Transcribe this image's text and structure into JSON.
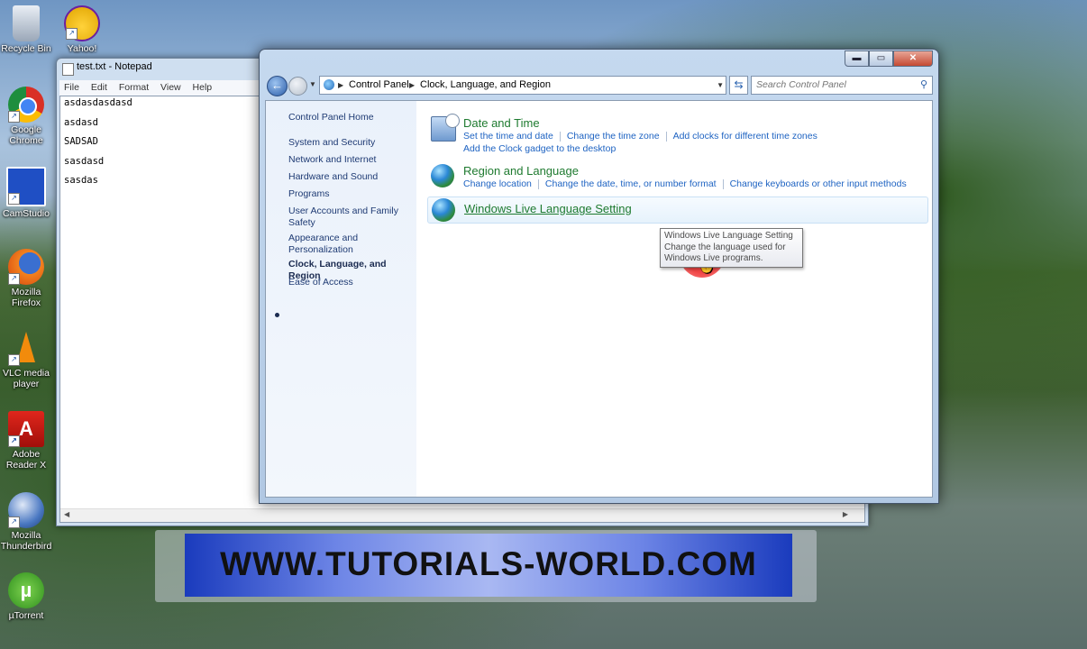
{
  "desktop": {
    "icons": [
      {
        "name": "recycle-bin",
        "label": "Recycle Bin"
      },
      {
        "name": "yahoo",
        "label": "Yahoo!"
      },
      {
        "name": "google-chrome",
        "label": "Google Chrome"
      },
      {
        "name": "camstudio",
        "label": "CamStudio"
      },
      {
        "name": "mozilla-firefox",
        "label": "Mozilla Firefox"
      },
      {
        "name": "vlc",
        "label": "VLC media player"
      },
      {
        "name": "adobe-reader",
        "label": "Adobe Reader X"
      },
      {
        "name": "thunderbird",
        "label": "Mozilla Thunderbird"
      },
      {
        "name": "utorrent",
        "label": "µTorrent"
      }
    ]
  },
  "notepad": {
    "title": "test.txt - Notepad",
    "menu": [
      "File",
      "Edit",
      "Format",
      "View",
      "Help"
    ],
    "lines": [
      "asdasdasdasd",
      "asdasd",
      "SADSAD",
      "sasdasd",
      "sasdas"
    ]
  },
  "control_panel": {
    "breadcrumb": [
      "Control Panel",
      "Clock, Language, and Region"
    ],
    "search_placeholder": "Search Control Panel",
    "sidebar": {
      "home": "Control Panel Home",
      "items": [
        "System and Security",
        "Network and Internet",
        "Hardware and Sound",
        "Programs",
        "User Accounts and Family Safety",
        "Appearance and Personalization",
        "Clock, Language, and Region",
        "Ease of Access"
      ],
      "active_index": 6
    },
    "categories": {
      "datetime": {
        "title": "Date and Time",
        "links": [
          "Set the time and date",
          "Change the time zone",
          "Add clocks for different time zones"
        ],
        "links2": [
          "Add the Clock gadget to the desktop"
        ]
      },
      "region": {
        "title": "Region and Language",
        "links": [
          "Change location",
          "Change the date, time, or number format",
          "Change keyboards or other input methods"
        ]
      },
      "winlive": {
        "title": "Windows Live Language Setting"
      }
    },
    "tooltip": {
      "title": "Windows Live Language Setting",
      "body": "Change the language used for Windows Live programs."
    }
  },
  "watermark": {
    "text": "WWW.TUTORIALS-WORLD.COM"
  }
}
